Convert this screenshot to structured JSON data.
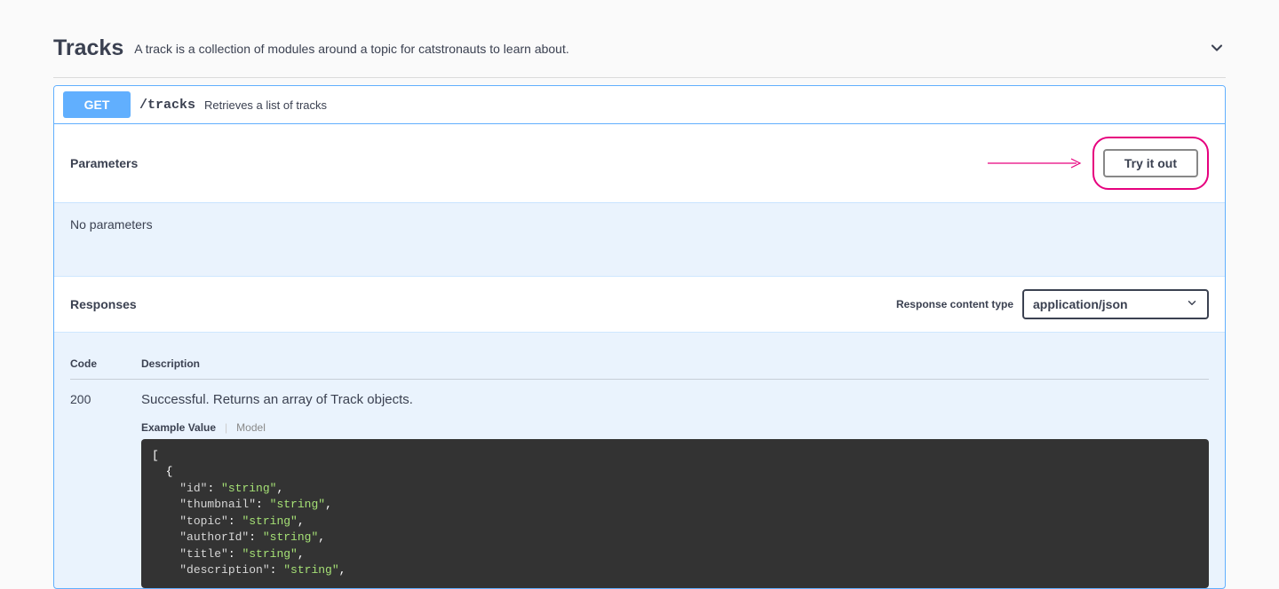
{
  "tag": {
    "name": "Tracks",
    "description": "A track is a collection of modules around a topic for catstronauts to learn about."
  },
  "operation": {
    "method": "GET",
    "path": "/tracks",
    "summary": "Retrieves a list of tracks"
  },
  "parameters": {
    "heading": "Parameters",
    "try_it_out": "Try it out",
    "empty": "No parameters"
  },
  "responses": {
    "heading": "Responses",
    "content_type_label": "Response content type",
    "content_type_value": "application/json",
    "columns": {
      "code": "Code",
      "description": "Description"
    },
    "items": [
      {
        "code": "200",
        "description": "Successful. Returns an array of Track objects.",
        "tabs": {
          "example": "Example Value",
          "model": "Model"
        },
        "example_fields": [
          "id",
          "thumbnail",
          "topic",
          "authorId",
          "title",
          "description"
        ],
        "example_type": "string"
      }
    ]
  }
}
